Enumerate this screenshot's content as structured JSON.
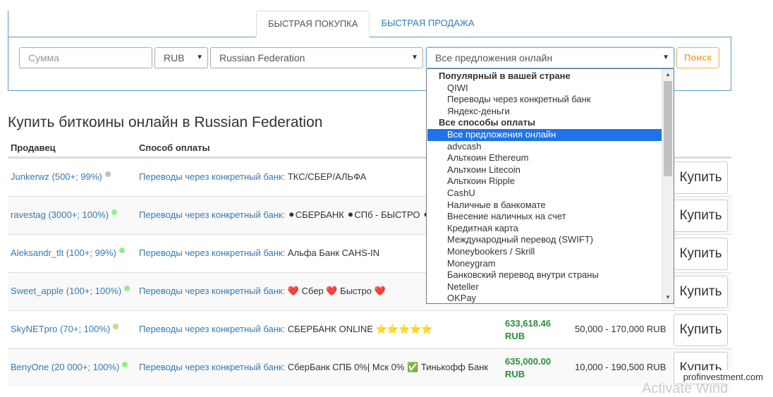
{
  "tabs": [
    {
      "label": "БЫСТРАЯ ПОКУПКА",
      "active": true
    },
    {
      "label": "БЫСТРАЯ ПРОДАЖА",
      "active": false
    }
  ],
  "search": {
    "amount_placeholder": "Сумма",
    "currency": "RUB",
    "country": "Russian Federation",
    "method": "Все предложения онлайн",
    "button": "Поиск"
  },
  "heading": "Купить биткоины онлайн в Russian Federation",
  "table": {
    "headers": {
      "seller": "Продавец",
      "payment": "Способ оплаты"
    },
    "buy_label": "Купить",
    "rows": [
      {
        "seller": "Junkerwz (500+; 99%)",
        "status": "#c0c0c0",
        "method": "Переводы через конкретный банк:",
        "detail": "ТКС/СБЕР/АЛЬФА",
        "price": "",
        "limits": ""
      },
      {
        "seller": "ravestag (3000+; 100%)",
        "status": "#90ee90",
        "method": "Переводы через конкретный банк:",
        "detail": "⚫СБЕРБАНК ⚫СПб - БЫСТРО ⚫",
        "price": "",
        "limits": ""
      },
      {
        "seller": "Aleksandr_tlt (100+; 99%)",
        "status": "#90ee90",
        "method": "Переводы через конкретный банк:",
        "detail": "Альфа Банк CAHS-IN",
        "price": "",
        "limits": ""
      },
      {
        "seller": "Sweet_apple (100+; 100%)",
        "status": "#90ee90",
        "method": "Переводы через конкретный банк:",
        "detail": "❤️ Сбер ❤️ Быстро ❤️",
        "price": "",
        "limits": ""
      },
      {
        "seller": "SkyNETpro (70+; 100%)",
        "status": "#d4d48a",
        "method": "Переводы через конкретный банк:",
        "detail": "СБЕРБАНК ONLINE ⭐⭐⭐⭐⭐",
        "price": "633,618.46\nRUB",
        "limits": "50,000 - 170,000 RUB"
      },
      {
        "seller": "BenyOne (20 000+; 100%)",
        "status": "#90ee90",
        "method": "Переводы через конкретный банк:",
        "detail": "СберБанк СПБ 0%| Мск 0% ✅ Тинькофф Банк",
        "price": "635,000.00\nRUB",
        "limits": "10,000 - 190,500 RUB"
      }
    ]
  },
  "dropdown": {
    "options": [
      {
        "label": "Популярный в вашей стране",
        "group": true
      },
      {
        "label": "QIWI"
      },
      {
        "label": "Переводы через конкретный банк"
      },
      {
        "label": "Яндекс-деньги"
      },
      {
        "label": "Все способы оплаты",
        "group": true
      },
      {
        "label": "Все предложения онлайн",
        "selected": true
      },
      {
        "label": "advcash"
      },
      {
        "label": "Альткоин Ethereum"
      },
      {
        "label": "Альткоин Litecoin"
      },
      {
        "label": "Альткоин Ripple"
      },
      {
        "label": "CashU"
      },
      {
        "label": "Наличные в банкомате"
      },
      {
        "label": "Внесение наличных на счет"
      },
      {
        "label": "Кредитная карта"
      },
      {
        "label": "Международный перевод (SWIFT)"
      },
      {
        "label": "Moneybookers / Skrill"
      },
      {
        "label": "Moneygram"
      },
      {
        "label": "Банковский перевод внутри страны"
      },
      {
        "label": "Neteller"
      },
      {
        "label": "OKPay"
      }
    ]
  },
  "watermark": "profinvestment.com",
  "faint_text": "Activate Wind"
}
